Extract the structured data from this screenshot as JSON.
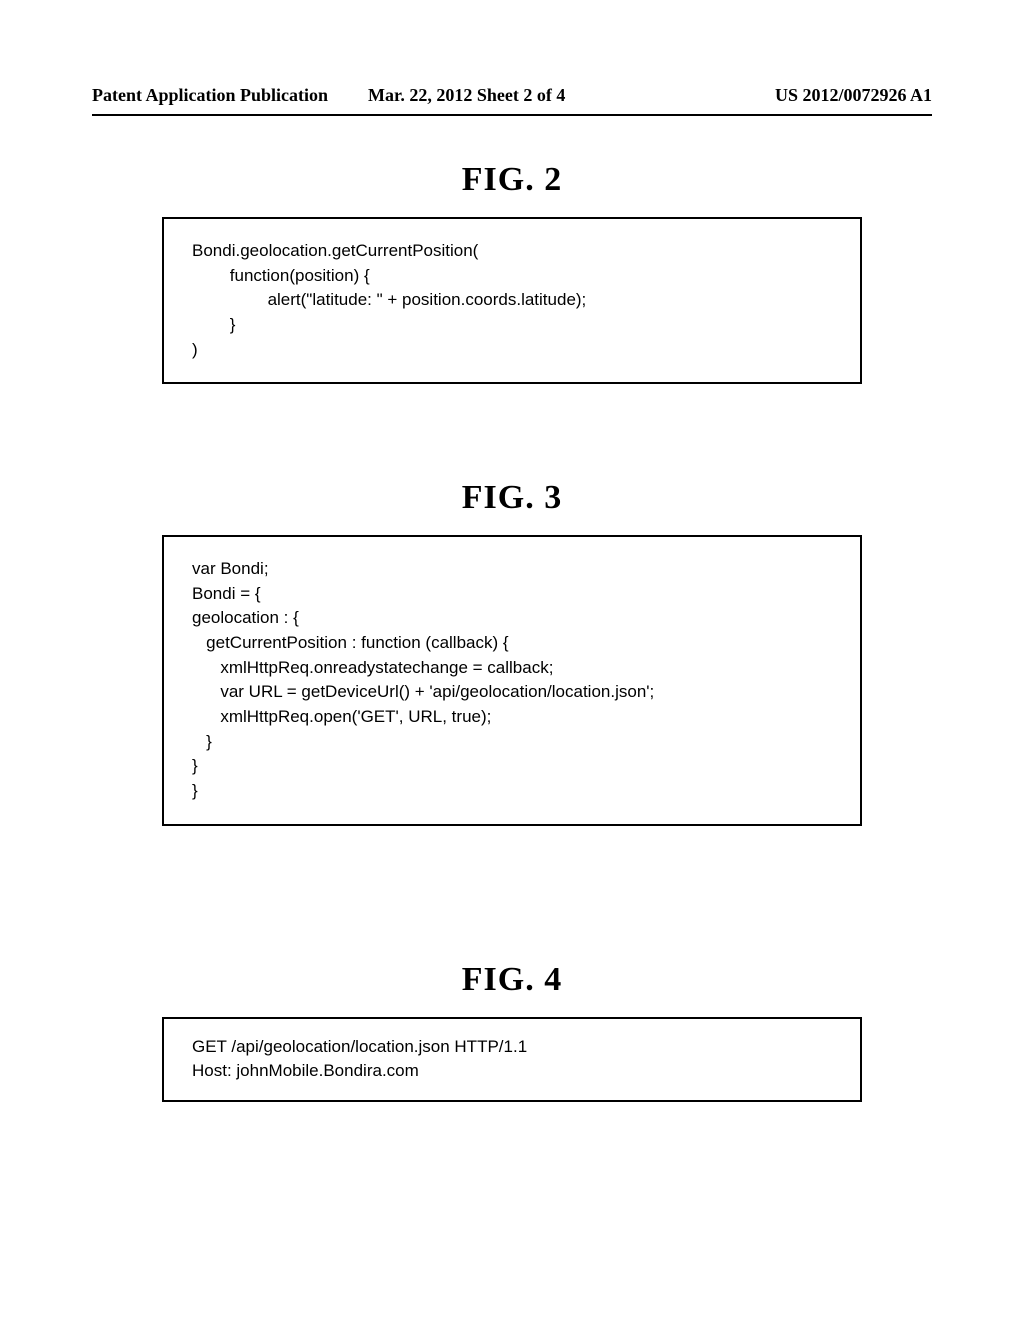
{
  "header": {
    "left": "Patent Application Publication",
    "center": "Mar. 22, 2012  Sheet 2 of 4",
    "right": "US 2012/0072926 A1"
  },
  "figures": {
    "fig2": {
      "title": "FIG.  2",
      "code": "Bondi.geolocation.getCurrentPosition(\n        function(position) {\n                alert(\"latitude: \" + position.coords.latitude);\n        }\n)"
    },
    "fig3": {
      "title": "FIG.  3",
      "code": "var Bondi;\nBondi = {\ngeolocation : {\n   getCurrentPosition : function (callback) {\n      xmlHttpReq.onreadystatechange = callback;\n      var URL = getDeviceUrl() + 'api/geolocation/location.json';\n      xmlHttpReq.open('GET', URL, true);\n   }\n}\n}"
    },
    "fig4": {
      "title": "FIG.  4",
      "code": "GET /api/geolocation/location.json HTTP/1.1\nHost: johnMobile.Bondira.com"
    }
  }
}
